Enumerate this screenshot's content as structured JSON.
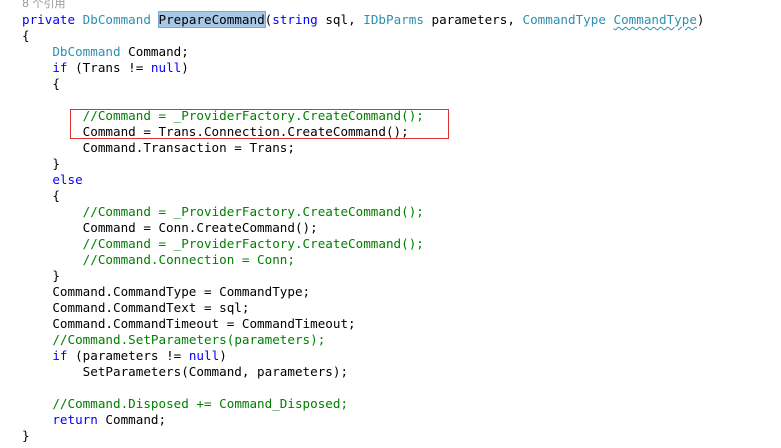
{
  "codelens": "8 个引用",
  "lines": [
    [
      [
        "kw",
        "private"
      ],
      [
        "pl",
        " "
      ],
      [
        "ty",
        "DbCommand"
      ],
      [
        "pl",
        " "
      ],
      [
        "hl",
        "PrepareCommand"
      ],
      [
        "pl",
        "("
      ],
      [
        "kw",
        "string"
      ],
      [
        "pl",
        " sql, "
      ],
      [
        "ty",
        "IDbParms"
      ],
      [
        "pl",
        " parameters, "
      ],
      [
        "ty",
        "CommandType"
      ],
      [
        "pl",
        " "
      ],
      [
        "squig",
        "CommandType"
      ],
      [
        "pl",
        ")"
      ]
    ],
    [
      [
        "pl",
        "{"
      ]
    ],
    [
      [
        "pl",
        "    "
      ],
      [
        "ty",
        "DbCommand"
      ],
      [
        "pl",
        " Command;"
      ]
    ],
    [
      [
        "pl",
        "    "
      ],
      [
        "kw",
        "if"
      ],
      [
        "pl",
        " (Trans != "
      ],
      [
        "kw",
        "null"
      ],
      [
        "pl",
        ")"
      ]
    ],
    [
      [
        "pl",
        "    {"
      ]
    ],
    [
      [
        "pl",
        ""
      ]
    ],
    [
      [
        "pl",
        "        "
      ],
      [
        "cm",
        "//Command = _ProviderFactory.CreateCommand();"
      ]
    ],
    [
      [
        "pl",
        "        Command = Trans.Connection.CreateCommand();"
      ]
    ],
    [
      [
        "pl",
        "        Command.Transaction = Trans;"
      ]
    ],
    [
      [
        "pl",
        "    }"
      ]
    ],
    [
      [
        "pl",
        "    "
      ],
      [
        "kw",
        "else"
      ]
    ],
    [
      [
        "pl",
        "    {"
      ]
    ],
    [
      [
        "pl",
        "        "
      ],
      [
        "cm",
        "//Command = _ProviderFactory.CreateCommand();"
      ]
    ],
    [
      [
        "pl",
        "        Command = Conn.CreateCommand();"
      ]
    ],
    [
      [
        "pl",
        "        "
      ],
      [
        "cm",
        "//Command = _ProviderFactory.CreateCommand();"
      ]
    ],
    [
      [
        "pl",
        "        "
      ],
      [
        "cm",
        "//Command.Connection = Conn;"
      ]
    ],
    [
      [
        "pl",
        "    }"
      ]
    ],
    [
      [
        "pl",
        "    Command.CommandType = CommandType;"
      ]
    ],
    [
      [
        "pl",
        "    Command.CommandText = sql;"
      ]
    ],
    [
      [
        "pl",
        "    Command.CommandTimeout = CommandTimeout;"
      ]
    ],
    [
      [
        "pl",
        "    "
      ],
      [
        "cm",
        "//Command.SetParameters(parameters);"
      ]
    ],
    [
      [
        "pl",
        "    "
      ],
      [
        "kw",
        "if"
      ],
      [
        "pl",
        " (parameters != "
      ],
      [
        "kw",
        "null"
      ],
      [
        "pl",
        ")"
      ]
    ],
    [
      [
        "pl",
        "        SetParameters(Command, parameters);"
      ]
    ],
    [
      [
        "pl",
        ""
      ]
    ],
    [
      [
        "pl",
        "    "
      ],
      [
        "cm",
        "//Command.Disposed += Command_Disposed;"
      ]
    ],
    [
      [
        "pl",
        "    "
      ],
      [
        "kw",
        "return"
      ],
      [
        "pl",
        " Command;"
      ]
    ],
    [
      [
        "pl",
        "}"
      ]
    ]
  ],
  "colors": {
    "keyword": "#0000ff",
    "type": "#2b91af",
    "comment": "#008000",
    "text": "#000000",
    "highlight": "#a8c8e8",
    "annotation_border": "#e03030",
    "codelens": "#999999"
  }
}
